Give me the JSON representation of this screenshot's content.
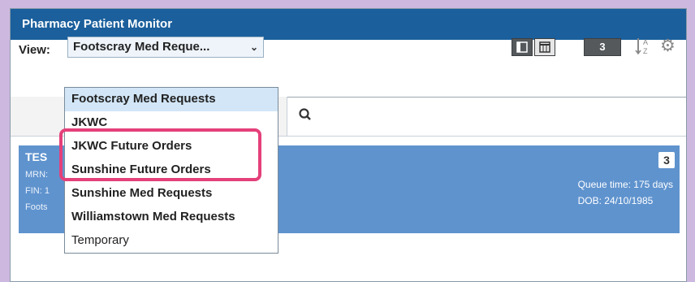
{
  "window": {
    "title": "Pharmacy Patient Monitor"
  },
  "toolbar": {
    "view_label": "View:",
    "view_selected": "Footscray Med Reque...",
    "count_badge": "3",
    "icons": [
      "list-view-icon",
      "table-view-icon",
      "sort-az-icon",
      "gear-icon"
    ]
  },
  "dropdown": {
    "options": [
      "Footscray Med Requests",
      "JKWC",
      "JKWC Future Orders",
      "Sunshine Future Orders",
      "Sunshine Med Requests",
      "Williamstown Med Requests",
      "Temporary"
    ],
    "selected_index": 0,
    "highlighted_options": [
      "JKWC Future Orders",
      "Sunshine Future Orders"
    ]
  },
  "patient": {
    "name": "TES",
    "mrn_label": "MRN:",
    "fin_label": "FIN: 1",
    "location": "Foots",
    "count": "3",
    "queue_time": "Queue time: 175 days",
    "dob": "DOB: 24/10/1985"
  },
  "colors": {
    "titlebar": "#1b5f9c",
    "patient_row": "#5f93ce",
    "highlight": "#e4407a",
    "selected_option": "#d2e6f7"
  }
}
